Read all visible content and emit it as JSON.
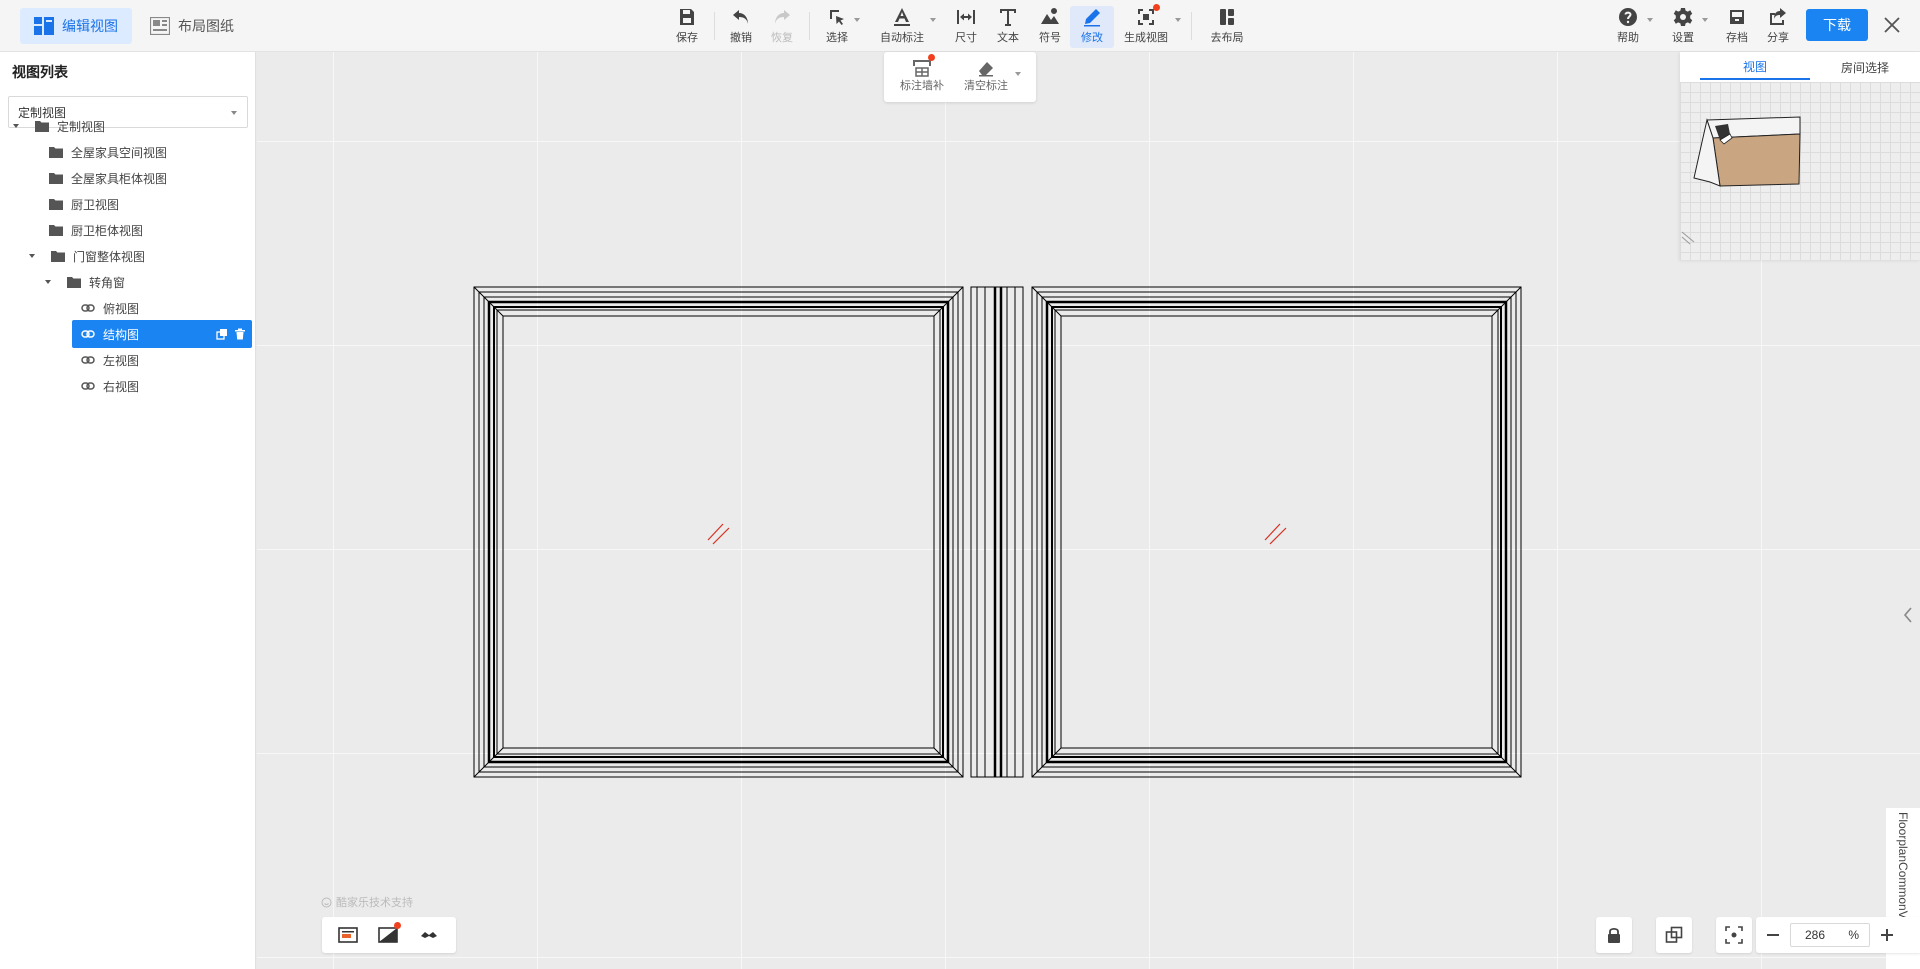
{
  "modes": {
    "edit_view": "编辑视图",
    "layout_sheet": "布局图纸"
  },
  "toolbar": {
    "save": "保存",
    "undo": "撤销",
    "redo": "恢复",
    "select": "选择",
    "auto_annotate": "自动标注",
    "dimension": "尺寸",
    "text": "文本",
    "symbol": "符号",
    "modify": "修改",
    "generate_view": "生成视图",
    "go_layout": "去布局",
    "help": "帮助",
    "settings": "设置",
    "archive": "存档",
    "share": "分享",
    "download": "下载"
  },
  "subtoolbar": {
    "wall_supplement": "标注墙补",
    "clear_annotation": "清空标注"
  },
  "sidebar": {
    "title": "视图列表",
    "select_value": "定制视图",
    "tree": [
      {
        "label": "定制视图"
      },
      {
        "label": "全屋家具空间视图"
      },
      {
        "label": "全屋家具柜体视图"
      },
      {
        "label": "厨卫视图"
      },
      {
        "label": "厨卫柜体视图"
      },
      {
        "label": "门窗整体视图"
      },
      {
        "label": "转角窗"
      },
      {
        "label": "俯视图"
      },
      {
        "label": "结构图"
      },
      {
        "label": "左视图"
      },
      {
        "label": "右视图"
      }
    ]
  },
  "minimap": {
    "tab_view": "视图",
    "tab_room": "房间选择"
  },
  "watermark": "酷家乐技术支持",
  "zoom": {
    "value": "286",
    "unit": "%"
  },
  "vertical_label": "FloorplanCommonViewer",
  "colors": {
    "accent": "#1a84f2",
    "badge": "#f0401e",
    "selected_row": "#1a84f2"
  }
}
